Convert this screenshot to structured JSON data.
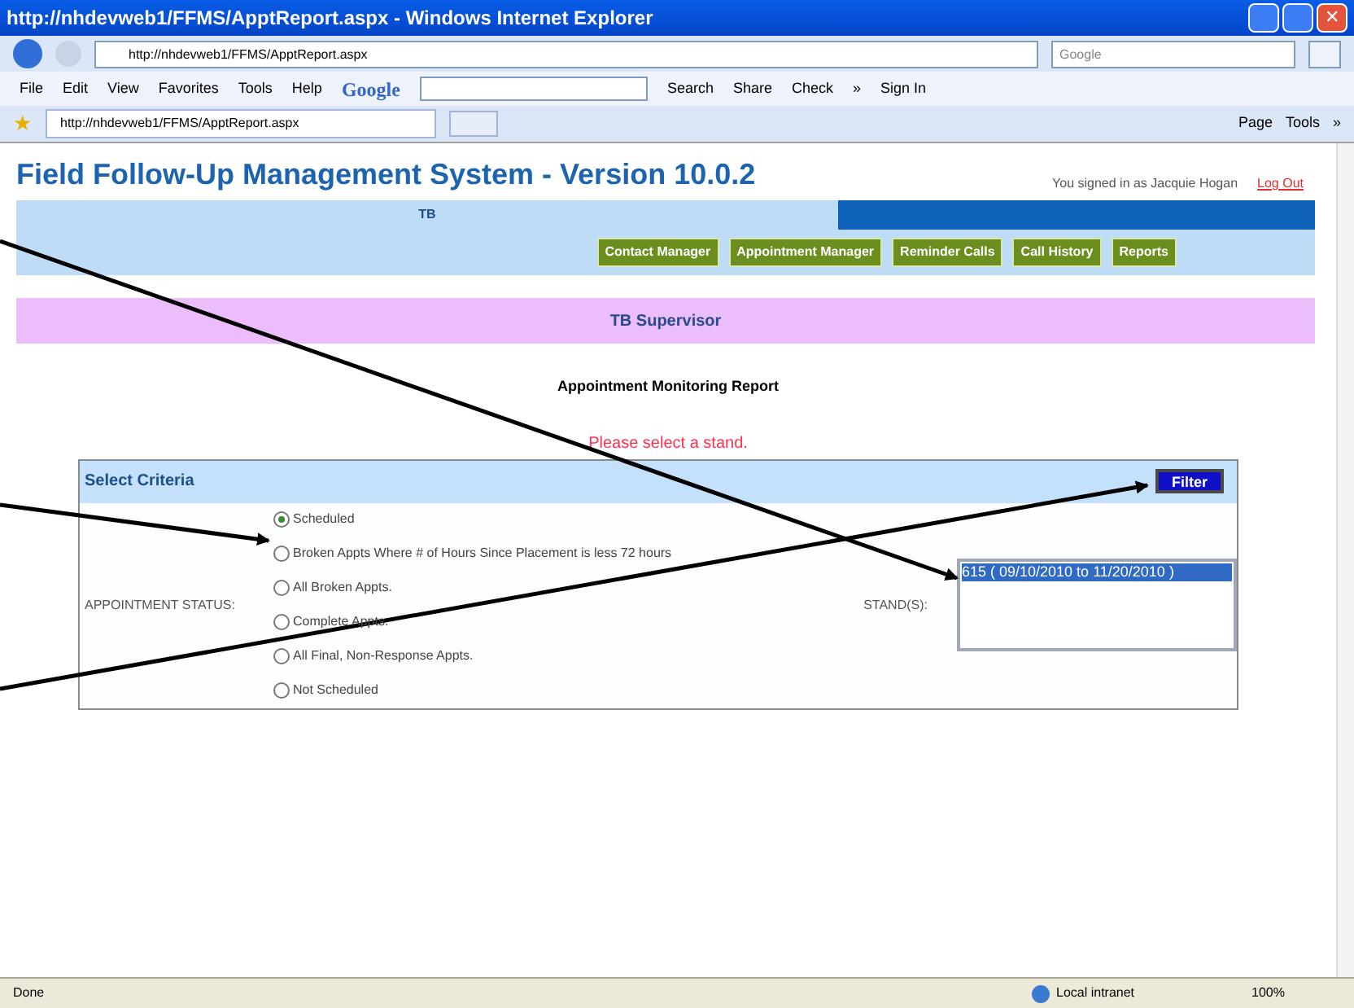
{
  "window": {
    "title": "http://nhdevweb1/FFMS/ApptReport.aspx - Windows Internet Explorer"
  },
  "address_bar": {
    "url": "http://nhdevweb1/FFMS/ApptReport.aspx",
    "search_placeholder": "Google"
  },
  "toolbar": {
    "menus": [
      "File",
      "Edit",
      "View",
      "Favorites",
      "Tools",
      "Help"
    ],
    "google_logo": "Google",
    "items": [
      "Search",
      "Share",
      "Check",
      "»",
      "Sign In"
    ]
  },
  "tabs": [
    {
      "label": "http://nhdevweb1/FFMS/ApptReport.aspx",
      "selected": true
    }
  ],
  "command_bar": [
    "Page",
    "Tools",
    "»"
  ],
  "page": {
    "title": "Field Follow-Up Management System - Version 10.0.2",
    "signed_in": "You signed in as Jacquie Hogan",
    "logout": "Log Out",
    "band": "TB",
    "nav": [
      "Contact Manager",
      "Appointment Manager",
      "Reminder Calls",
      "Call History",
      "Reports"
    ],
    "role": "TB Supervisor",
    "report_title": "Appointment Monitoring Report",
    "error": "Please select a stand.",
    "criteria": {
      "title": "Select Criteria",
      "filter": "Filter",
      "status_label": "APPOINTMENT STATUS:",
      "stand_label": "STAND(S):",
      "options": [
        {
          "label": "Scheduled",
          "selected": true
        },
        {
          "label": "Broken Appts Where # of Hours Since Placement is less 72 hours",
          "selected": false
        },
        {
          "label": "All Broken Appts.",
          "selected": false
        },
        {
          "label": "Complete Appts.",
          "selected": false
        },
        {
          "label": "All Final, Non-Response Appts.",
          "selected": false
        },
        {
          "label": "Not Scheduled",
          "selected": false
        }
      ],
      "stands": [
        {
          "label": "615 ( 09/10/2010 to 11/20/2010 )",
          "selected": true
        }
      ]
    }
  },
  "window_controls": [
    "✕"
  ],
  "favorites_icon": "★",
  "status_bar": {
    "text": "Done",
    "zone": "Local intranet",
    "zoom": "100%"
  }
}
